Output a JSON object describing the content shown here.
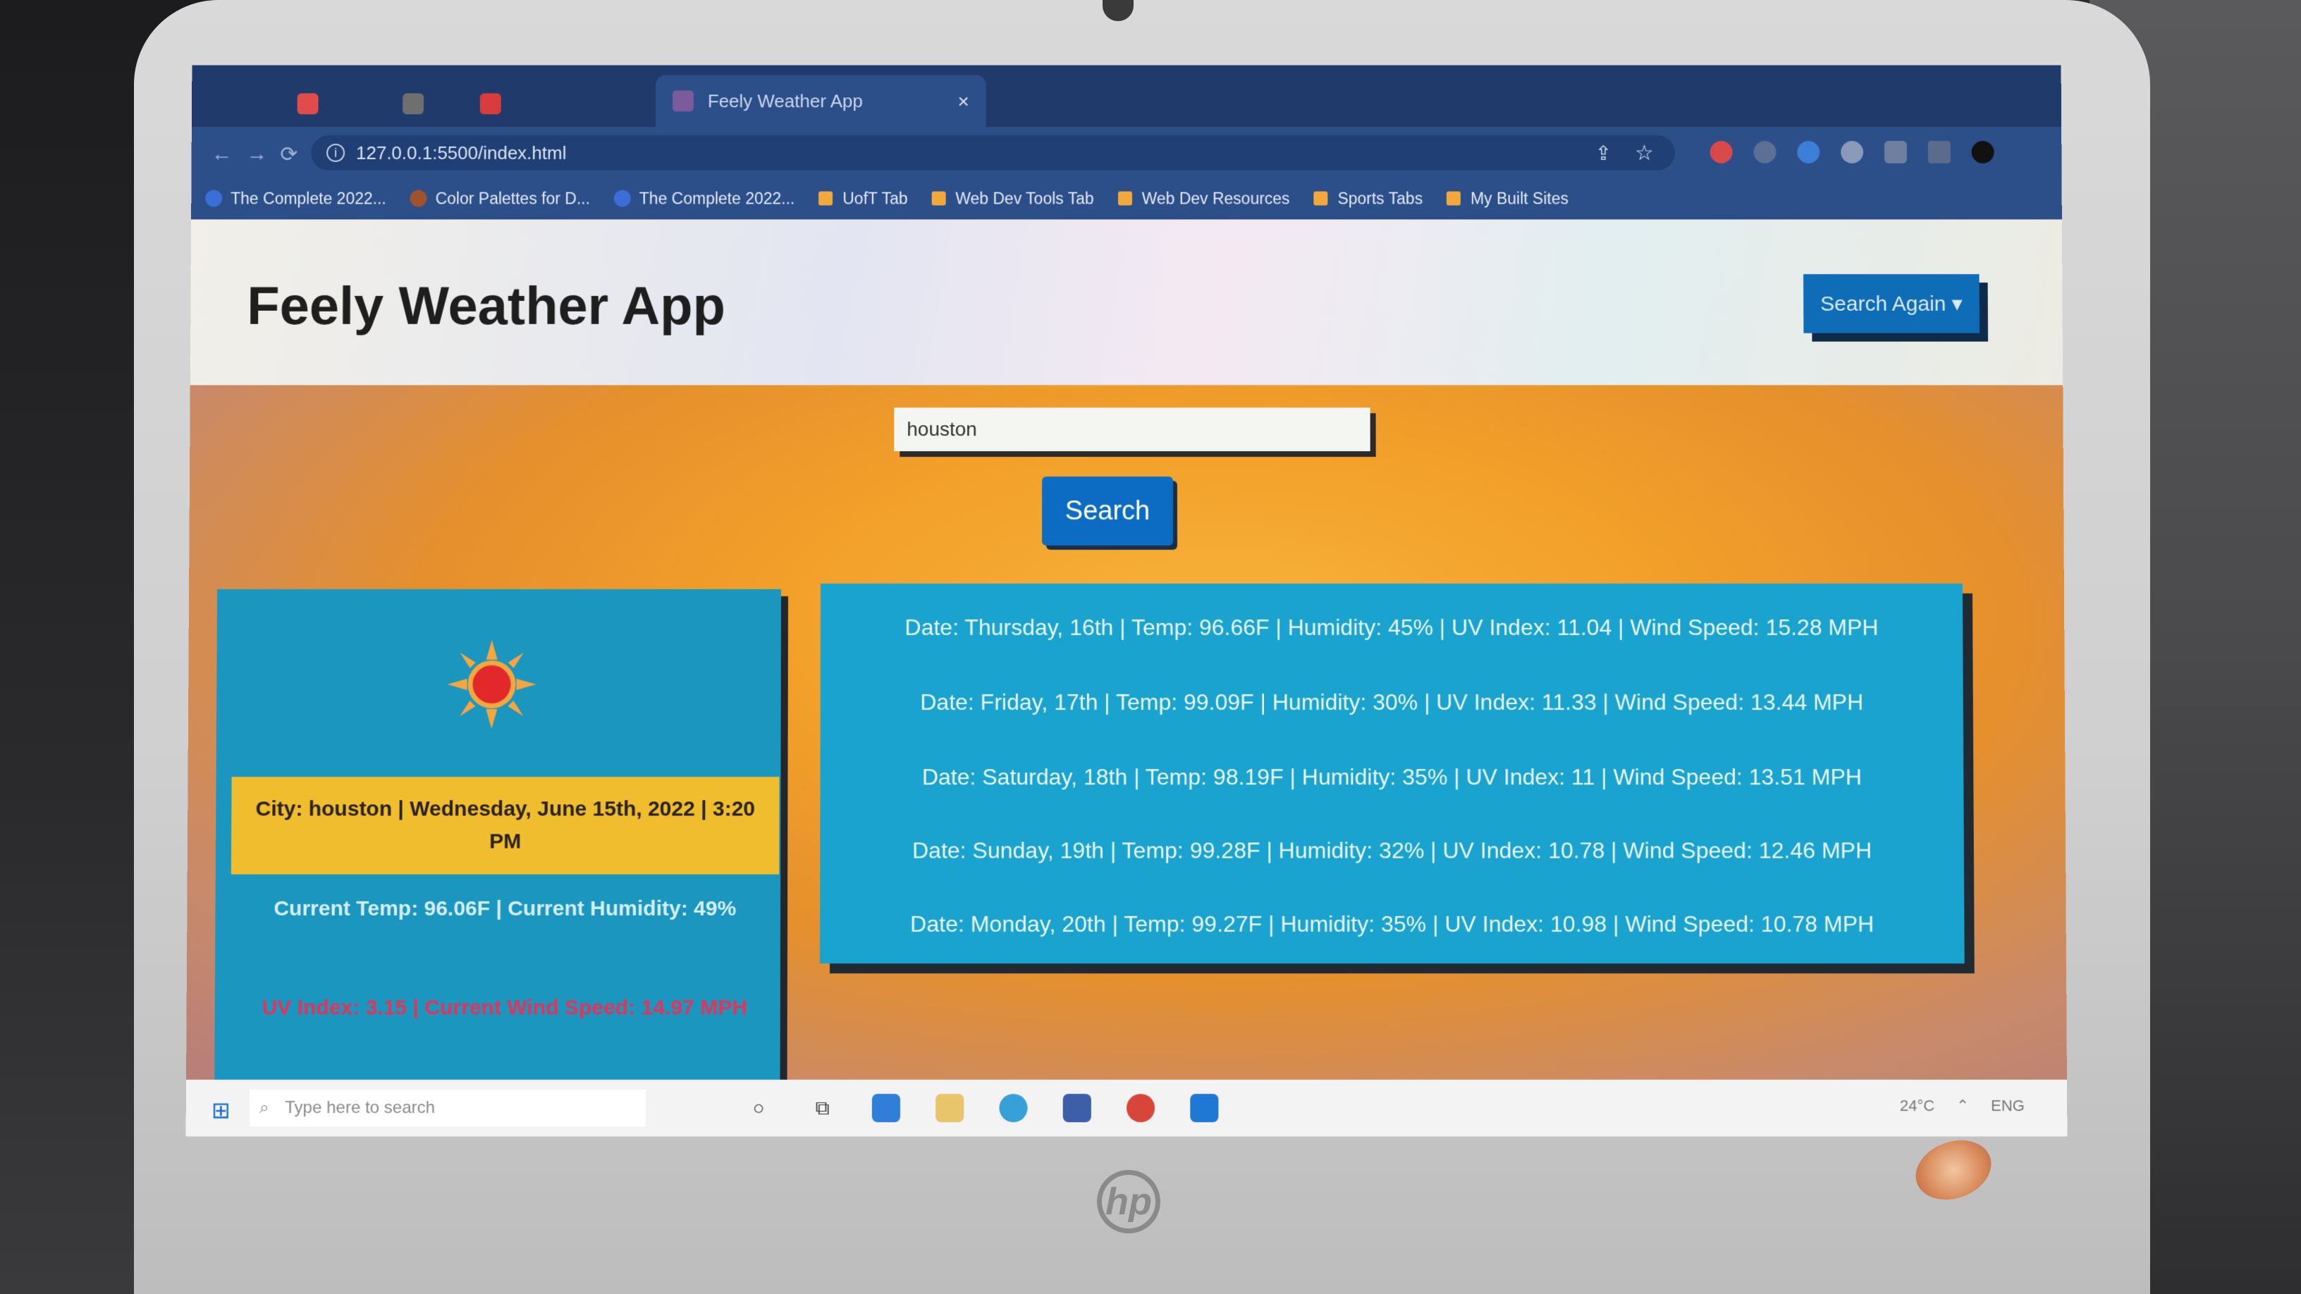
{
  "browser": {
    "tab_title": "Feely Weather App",
    "tab_close": "×",
    "url": "127.0.0.1:5500/index.html",
    "bookmarks": [
      {
        "label": "The Complete 2022...",
        "type": "site"
      },
      {
        "label": "Color Palettes for D...",
        "type": "site"
      },
      {
        "label": "The Complete 2022...",
        "type": "site"
      },
      {
        "label": "UofT Tab",
        "type": "folder"
      },
      {
        "label": "Web Dev Tools Tab",
        "type": "folder"
      },
      {
        "label": "Web Dev Resources",
        "type": "folder"
      },
      {
        "label": "Sports Tabs",
        "type": "folder"
      },
      {
        "label": "My Built Sites",
        "type": "folder"
      }
    ]
  },
  "app": {
    "title": "Feely Weather App",
    "search_again_label": "Search Again ▾",
    "search_input_value": "houston",
    "search_button_label": "Search"
  },
  "current": {
    "icon": "sun-icon",
    "city_line": "City: houston | Wednesday, June 15th, 2022 | 3:20 PM",
    "temp_line": "Current Temp: 96.06F | Current Humidity: 49%",
    "uv_line": "UV Index: 3.15 | Current Wind Speed: 14.97 MPH"
  },
  "forecast": [
    "Date: Thursday, 16th | Temp: 96.66F | Humidity: 45% | UV Index: 11.04 | Wind Speed: 15.28 MPH",
    "Date: Friday, 17th | Temp: 99.09F | Humidity: 30% | UV Index: 11.33 | Wind Speed: 13.44 MPH",
    "Date: Saturday, 18th | Temp: 98.19F | Humidity: 35% | UV Index: 11 | Wind Speed: 13.51 MPH",
    "Date: Sunday, 19th | Temp: 99.28F | Humidity: 32% | UV Index: 10.78 | Wind Speed: 12.46 MPH",
    "Date: Monday, 20th | Temp: 99.27F | Humidity: 35% | UV Index: 10.98 | Wind Speed: 10.78 MPH"
  ],
  "taskbar": {
    "search_placeholder": "Type here to search",
    "weather": "24°C",
    "language": "ENG"
  },
  "device": {
    "brand": "hp"
  },
  "colors": {
    "header_btn": "#0f6cb6",
    "search_btn": "#0c6cc3",
    "current_card": "#1b96bf",
    "city_row": "#efbd2e",
    "forecast_card": "#1aa3cf",
    "uv_text": "#e3345a"
  }
}
